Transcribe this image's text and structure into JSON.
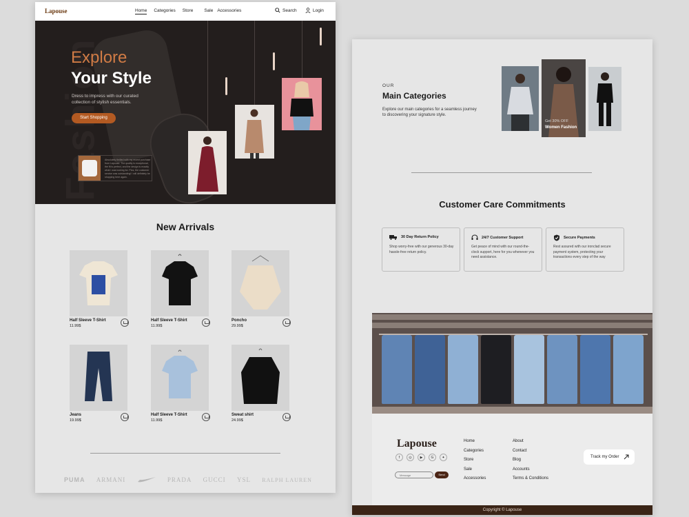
{
  "nav": {
    "logo": "Lapouse",
    "links": [
      "Home",
      "Categories",
      "Store",
      "Sale",
      "Accessories"
    ],
    "search_label": "Search",
    "login_label": "Login"
  },
  "hero": {
    "bg_word": "Fashion",
    "title_line1": "Explore",
    "title_line2": "Your Style",
    "subtitle": "Dress to impress with our curated collection of stylish essentials.",
    "cta_label": "Start Shopping",
    "testimonial": "Absolutely thrilled with my recent purchase from Lapouse. The quality is exceptional, the fit is perfect, and the design is exactly what I was looking for. Plus, the customer service was outstanding! I will definitely be shopping here again."
  },
  "new_arrivals": {
    "title": "New Arrivals",
    "products": [
      {
        "name": "Half Sleeve T-Shirt",
        "price": "11.99$"
      },
      {
        "name": "Half Sleeve T-Shirt",
        "price": "11.99$"
      },
      {
        "name": "Poncho",
        "price": "29.99$"
      },
      {
        "name": "Jeans",
        "price": "19.99$"
      },
      {
        "name": "Half Sleeve T-Shirt",
        "price": "11.99$"
      },
      {
        "name": "Sweat shirt",
        "price": "24.99$"
      }
    ]
  },
  "brands": [
    "PUMA",
    "ARMANI",
    "NIKE",
    "PRADA",
    "GUCCI",
    "YSL",
    "RALPH LAUREN"
  ],
  "categories": {
    "eyebrow": "OUR",
    "title": "Main Categories",
    "subtitle": "Explore our main categories for a seamless journey to discovering your signature style.",
    "feature_offer": "Get 30% OFF",
    "feature_label": "Women Fashion"
  },
  "care": {
    "title": "Customer Care Commitments",
    "cards": [
      {
        "title": "30 Day Return Policy",
        "text": "Shop worry-free with our generous 30-day hassle-free return policy."
      },
      {
        "title": "24/7 Customer Support",
        "text": "Get peace of mind with our round-the-clock support, here for you whenever you need assistance."
      },
      {
        "title": "Secure Payments",
        "text": "Rest assured with our ironclad secure payment system, protecting your transactions every step of the way"
      }
    ]
  },
  "footer": {
    "logo": "Lapouse",
    "message_placeholder": "Message",
    "send_label": "Send",
    "col1": [
      "Home",
      "Categories",
      "Store",
      "Sale",
      "Accessories"
    ],
    "col2": [
      "About",
      "Contact",
      "Blog",
      "Accounts",
      "Terms & Conditions"
    ],
    "track_label": "Track my Order",
    "copyright": "Copyright © Lapouse"
  },
  "colors": {
    "accent": "#b35a22",
    "dark_brown": "#3a2416",
    "hero_bg": "#231e1d"
  }
}
